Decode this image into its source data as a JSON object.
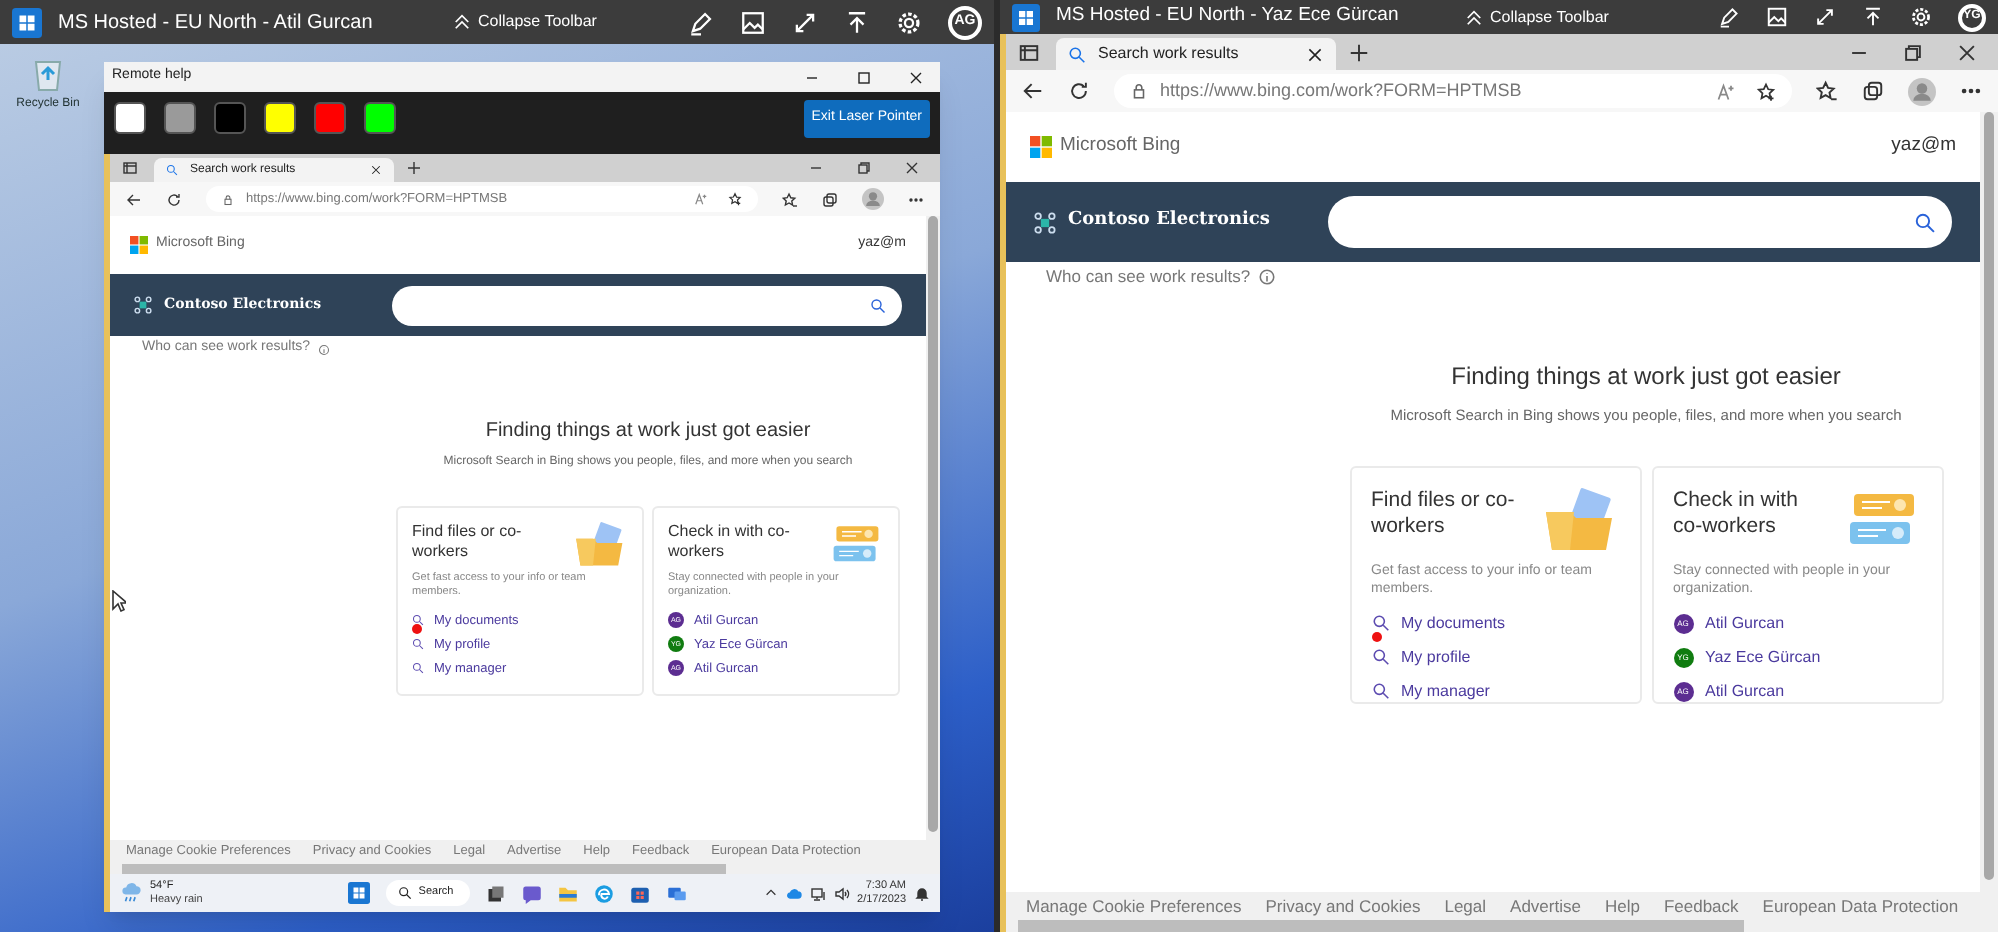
{
  "sessions": [
    {
      "title": "MS Hosted - EU North - Atil Gurcan",
      "collapse": "Collapse Toolbar",
      "avatar": "AG",
      "desktop_icons": [
        {
          "label": "Recycle Bin"
        }
      ],
      "remote_help": {
        "title": "Remote help",
        "swatches": [
          {
            "color": "#ffffff"
          },
          {
            "color": "#9a9a9a"
          },
          {
            "color": "#000000"
          },
          {
            "color": "#ffff00"
          },
          {
            "color": "#ff0000"
          },
          {
            "color": "#00ff00"
          }
        ],
        "exit_button": "Exit Laser Pointer"
      },
      "browser": {
        "tab": "Search work results",
        "url": "https://www.bing.com/work?FORM=HPTMSB",
        "brand": "Microsoft Bing",
        "user": "yaz@m",
        "org": "Contoso Electronics",
        "question": "Who can see work results?",
        "heading": "Finding things at work just got easier",
        "subheading": "Microsoft Search in Bing shows you people, files, and more when you search",
        "cards": [
          {
            "kind": "files",
            "title": "Find files or co-workers",
            "description": "Get fast access to your info or team members.",
            "links": [
              {
                "kind": "search",
                "label": "My documents",
                "laser_pointer": true
              },
              {
                "kind": "search",
                "label": "My profile",
                "laser_pointer": false
              },
              {
                "kind": "search",
                "label": "My manager",
                "laser_pointer": false
              }
            ]
          },
          {
            "kind": "people",
            "title": "Check in with co-workers",
            "description": "Stay connected with people in your organization.",
            "links": [
              {
                "kind": "person",
                "label": "Atil Gurcan",
                "initials": "AG",
                "color": "#5c2d91"
              },
              {
                "kind": "person",
                "label": "Yaz Ece Gürcan",
                "initials": "YG",
                "color": "#107c10"
              },
              {
                "kind": "person",
                "label": "Atil Gurcan",
                "initials": "AG",
                "color": "#5c2d91"
              }
            ]
          }
        ],
        "footer": [
          "Manage Cookie Preferences",
          "Privacy and Cookies",
          "Legal",
          "Advertise",
          "Help",
          "Feedback",
          "European Data Protection"
        ]
      },
      "taskbar": {
        "temperature": "54°F",
        "weather": "Heavy rain",
        "search": "Search",
        "time": "7:30 AM",
        "date": "2/17/2023"
      }
    },
    {
      "title": "MS Hosted - EU North - Yaz Ece Gürcan",
      "collapse": "Collapse Toolbar",
      "avatar": "YG",
      "browser": {
        "tab": "Search work results",
        "url": "https://www.bing.com/work?FORM=HPTMSB",
        "brand": "Microsoft Bing",
        "user": "yaz@m",
        "org": "Contoso Electronics",
        "question": "Who can see work results?",
        "heading": "Finding things at work just got easier",
        "subheading": "Microsoft Search in Bing shows you people, files, and more when you search",
        "cards": [
          {
            "kind": "files",
            "title": "Find files or co-workers",
            "description": "Get fast access to your info or team members.",
            "links": [
              {
                "kind": "search",
                "label": "My documents",
                "laser_pointer": true
              },
              {
                "kind": "search",
                "label": "My profile",
                "laser_pointer": false
              },
              {
                "kind": "search",
                "label": "My manager",
                "laser_pointer": false
              }
            ]
          },
          {
            "kind": "people",
            "title": "Check in with co-workers",
            "description": "Stay connected with people in your organization.",
            "links": [
              {
                "kind": "person",
                "label": "Atil Gurcan",
                "initials": "AG",
                "color": "#5c2d91"
              },
              {
                "kind": "person",
                "label": "Yaz Ece Gürcan",
                "initials": "YG",
                "color": "#107c10"
              },
              {
                "kind": "person",
                "label": "Atil Gurcan",
                "initials": "AG",
                "color": "#5c2d91"
              }
            ]
          }
        ],
        "footer": [
          "Manage Cookie Preferences",
          "Privacy and Cookies",
          "Legal",
          "Advertise",
          "Help",
          "Feedback",
          "European Data Protection"
        ]
      }
    }
  ]
}
